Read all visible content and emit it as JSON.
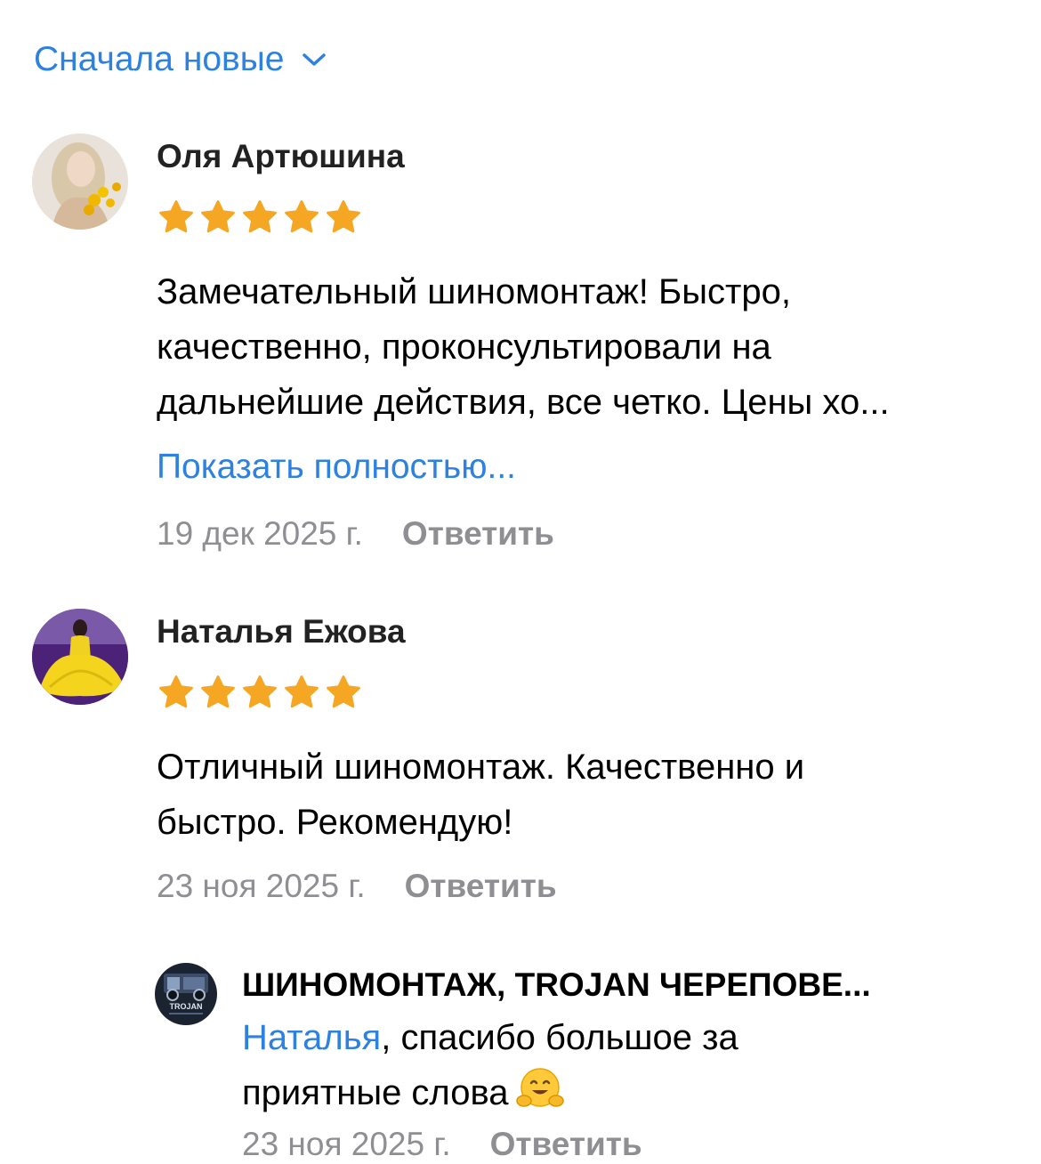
{
  "sort": {
    "label": "Сначала новые",
    "icon": "chevron-down-icon"
  },
  "reviews": [
    {
      "author": "Оля Артюшина",
      "rating": 5,
      "text_lines": [
        "Замечательный шиномонтаж! Быстро,",
        "качественно, проконсультировали на",
        "дальнейшие действия, все четко. Цены хо..."
      ],
      "show_more": "Показать полностью...",
      "date": "19 дек 2025 г.",
      "reply": "Ответить"
    },
    {
      "author": "Наталья Ежова",
      "rating": 5,
      "text_lines": [
        "Отличный шиномонтаж. Качественно и",
        "быстро. Рекомендую!"
      ],
      "date": "23 ноя 2025 г.",
      "reply": "Ответить"
    }
  ],
  "owner_reply": {
    "author": "ШИНОМОНТАЖ, TROJAN ЧЕРЕПОВЕ...",
    "avatar_text": "TROJAN",
    "mention": "Наталья",
    "text_after_mention": ", спасибо большое за",
    "text_line2": "приятные слова",
    "emoji": "hugging-face-icon",
    "date": "23 ноя 2025 г.",
    "reply": "Ответить"
  },
  "colors": {
    "accent": "#2d81e0",
    "star": "#f5a623",
    "meta": "#8e8e93"
  }
}
